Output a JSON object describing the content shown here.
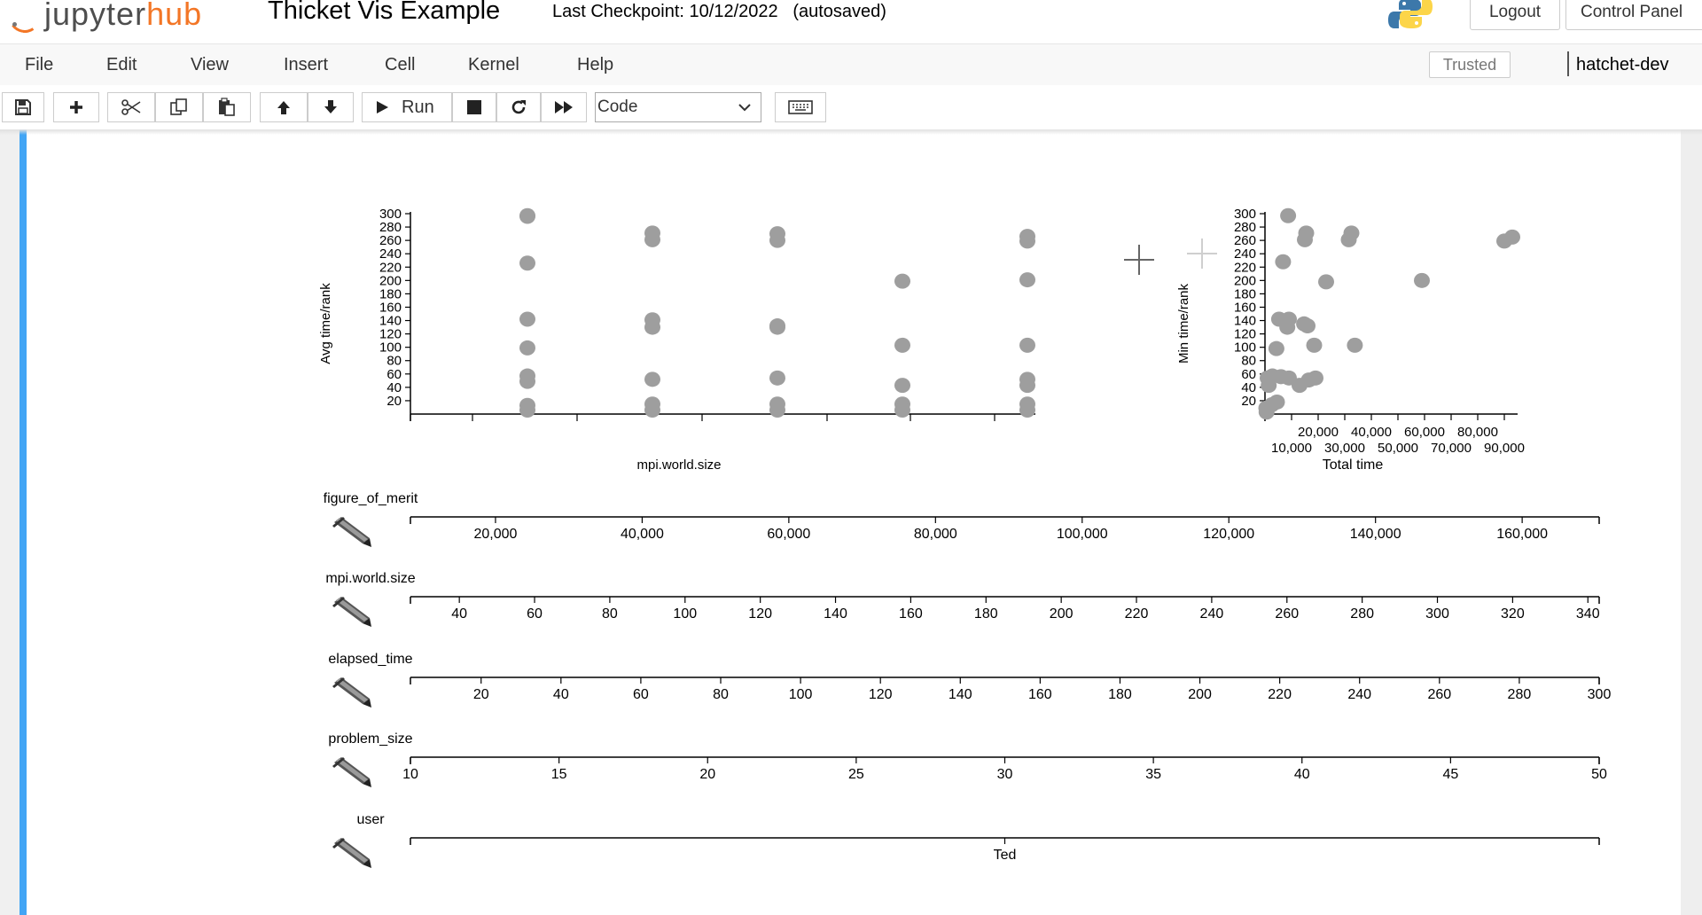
{
  "header": {
    "logo_text_a": "jupyter",
    "logo_text_b": "hub",
    "notebook_title": "Thicket Vis Example",
    "checkpoint": "Last Checkpoint: 10/12/2022",
    "autosaved": "(autosaved)",
    "logout_label": "Logout",
    "control_panel_label": "Control Panel"
  },
  "menubar": {
    "items": [
      "File",
      "Edit",
      "View",
      "Insert",
      "Cell",
      "Kernel",
      "Help"
    ],
    "trusted_label": "Trusted",
    "kernel_name": "hatchet-dev"
  },
  "toolbar": {
    "run_label": "Run",
    "cell_type": "Code"
  },
  "chart_data": [
    {
      "type": "scatter",
      "ylabel": "Avg time/rank",
      "xlabel": "mpi.world.size",
      "y_ticks": [
        20,
        40,
        60,
        80,
        100,
        120,
        140,
        160,
        180,
        200,
        220,
        240,
        260,
        280,
        300
      ],
      "ylim": [
        0,
        300
      ],
      "x_groups": [
        1,
        2,
        3,
        4,
        5
      ],
      "points": [
        [
          1,
          297
        ],
        [
          1,
          296
        ],
        [
          1,
          226
        ],
        [
          1,
          142
        ],
        [
          1,
          99
        ],
        [
          1,
          57
        ],
        [
          1,
          49
        ],
        [
          1,
          13
        ],
        [
          1,
          6
        ],
        [
          2,
          271
        ],
        [
          2,
          261
        ],
        [
          2,
          141
        ],
        [
          2,
          130
        ],
        [
          2,
          52
        ],
        [
          2,
          15
        ],
        [
          2,
          6
        ],
        [
          3,
          270
        ],
        [
          3,
          260
        ],
        [
          3,
          132
        ],
        [
          3,
          130
        ],
        [
          3,
          54
        ],
        [
          3,
          15
        ],
        [
          3,
          6
        ],
        [
          4,
          199
        ],
        [
          4,
          103
        ],
        [
          4,
          43
        ],
        [
          4,
          15
        ],
        [
          4,
          6
        ],
        [
          5,
          266
        ],
        [
          5,
          259
        ],
        [
          5,
          201
        ],
        [
          5,
          103
        ],
        [
          5,
          52
        ],
        [
          5,
          43
        ],
        [
          5,
          15
        ],
        [
          5,
          6
        ]
      ],
      "point_color": "#9e9e9e"
    },
    {
      "type": "scatter",
      "ylabel": "Min time/rank",
      "xlabel": "Total time",
      "y_ticks": [
        20,
        40,
        60,
        80,
        100,
        120,
        140,
        160,
        180,
        200,
        220,
        240,
        260,
        280,
        300
      ],
      "x_ticks_top": [
        "20,000",
        "40,000",
        "60,000",
        "80,000"
      ],
      "x_ticks_bottom": [
        "10,000",
        "30,000",
        "50,000",
        "70,000",
        "90,000"
      ],
      "xlim": [
        0,
        95000
      ],
      "ylim": [
        0,
        300
      ],
      "points": [
        [
          8700,
          297
        ],
        [
          15500,
          271
        ],
        [
          15000,
          261
        ],
        [
          32500,
          271
        ],
        [
          31500,
          261
        ],
        [
          6800,
          228
        ],
        [
          5300,
          142
        ],
        [
          9000,
          142
        ],
        [
          8400,
          130
        ],
        [
          14700,
          135
        ],
        [
          16000,
          132
        ],
        [
          23000,
          198
        ],
        [
          59000,
          200
        ],
        [
          90000,
          259
        ],
        [
          93000,
          265
        ],
        [
          18500,
          103
        ],
        [
          33800,
          103
        ],
        [
          4300,
          98
        ],
        [
          1000,
          54
        ],
        [
          2800,
          57
        ],
        [
          6000,
          56
        ],
        [
          9000,
          54
        ],
        [
          13000,
          43
        ],
        [
          16500,
          51
        ],
        [
          19000,
          54
        ],
        [
          1400,
          43
        ],
        [
          4500,
          18
        ],
        [
          2600,
          14
        ],
        [
          500,
          9
        ],
        [
          600,
          3
        ]
      ],
      "point_color": "#9e9e9e"
    }
  ],
  "axes": [
    {
      "label": "figure_of_merit",
      "ticks": [
        "20,000",
        "40,000",
        "60,000",
        "80,000",
        "100,000",
        "120,000",
        "140,000",
        "160,000"
      ],
      "min": 8400,
      "max": 170500,
      "values": [
        20000,
        40000,
        60000,
        80000,
        100000,
        120000,
        140000,
        160000
      ]
    },
    {
      "label": "mpi.world.size",
      "ticks": [
        "40",
        "60",
        "80",
        "100",
        "120",
        "140",
        "160",
        "180",
        "200",
        "220",
        "240",
        "260",
        "280",
        "300",
        "320",
        "340"
      ],
      "min": 27,
      "max": 343,
      "values": [
        40,
        60,
        80,
        100,
        120,
        140,
        160,
        180,
        200,
        220,
        240,
        260,
        280,
        300,
        320,
        340
      ]
    },
    {
      "label": "elapsed_time",
      "ticks": [
        "20",
        "40",
        "60",
        "80",
        "100",
        "120",
        "140",
        "160",
        "180",
        "200",
        "220",
        "240",
        "260",
        "280",
        "300"
      ],
      "min": 2.3,
      "max": 300,
      "values": [
        20,
        40,
        60,
        80,
        100,
        120,
        140,
        160,
        180,
        200,
        220,
        240,
        260,
        280,
        300
      ]
    },
    {
      "label": "problem_size",
      "ticks": [
        "10",
        "15",
        "20",
        "25",
        "30",
        "35",
        "40",
        "45",
        "50"
      ],
      "min": 10,
      "max": 50,
      "values": [
        10,
        15,
        20,
        25,
        30,
        35,
        40,
        45,
        50
      ]
    },
    {
      "label": "user",
      "ticks": [
        "Ted"
      ],
      "min": 0,
      "max": 1,
      "values": [
        0.5
      ]
    }
  ],
  "colors": {
    "cell_border": "#42a5f5",
    "points": "#9e9e9e",
    "orange": "#f37626"
  },
  "icons": {
    "axis_tool": "pencil-icon"
  }
}
